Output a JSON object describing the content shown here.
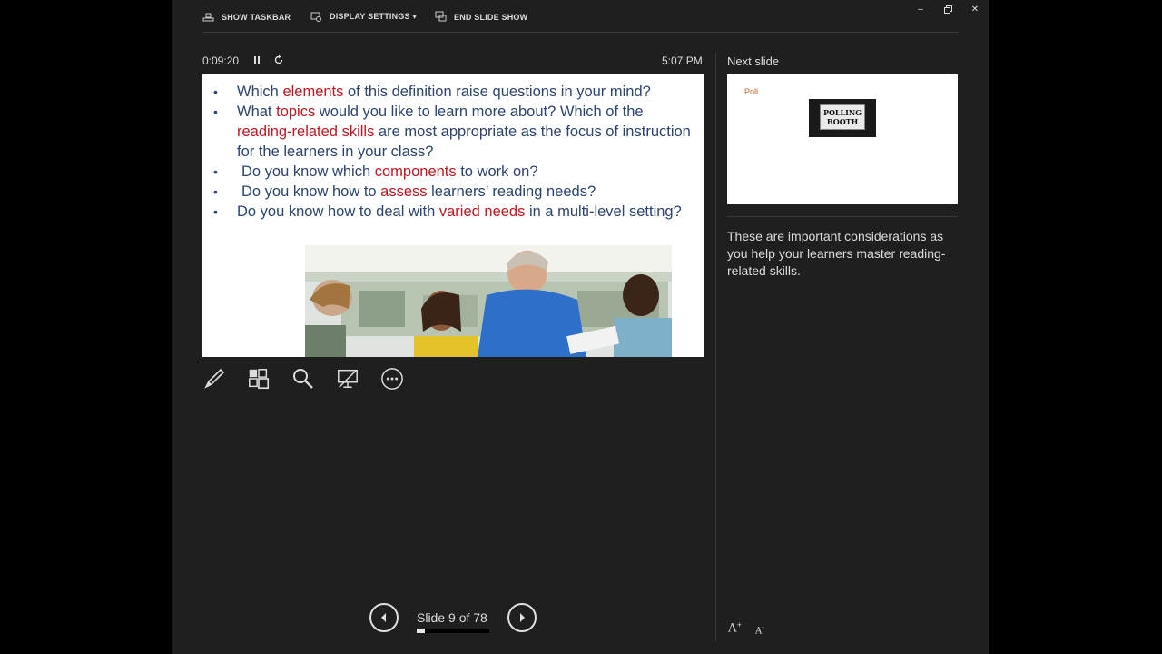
{
  "toolbar": {
    "show_taskbar": "SHOW TASKBAR",
    "display_settings": "DISPLAY SETTINGS ▾",
    "end_slide_show": "END SLIDE SHOW"
  },
  "window_controls": {
    "minimize": "–",
    "restore": "🗗",
    "close": "✕"
  },
  "timer": {
    "elapsed": "0:09:20",
    "clock": "5:07 PM"
  },
  "current_slide": {
    "bullets": [
      {
        "pre": "Which ",
        "hl": "elements",
        "post": " of this definition raise questions in your mind?"
      },
      {
        "pre": "What ",
        "hl": "topics",
        "mid": " would you like to learn more about? Which of the ",
        "hl2": "reading-related skills",
        "post": " are most appropriate as the focus of instruction for the learners in your class?"
      },
      {
        "pre": " Do you know which ",
        "hl": "components",
        "post": " to work on?"
      },
      {
        "pre": " Do you know how to ",
        "hl": "assess",
        "post": " learners’ reading needs?"
      },
      {
        "pre": "Do you know how to deal with ",
        "hl": "varied needs",
        "post": " in a multi-level setting?"
      }
    ]
  },
  "navigation": {
    "counter": "Slide 9 of 78",
    "progress": 0.115
  },
  "next_slide": {
    "label": "Next slide",
    "title": "Poll",
    "sign_text_line1": "POLLING",
    "sign_text_line2": "BOOTH"
  },
  "notes": "These are important considerations as you help your learners master reading-related skills.",
  "font_controls": {
    "increase": "A",
    "decrease": "A"
  }
}
